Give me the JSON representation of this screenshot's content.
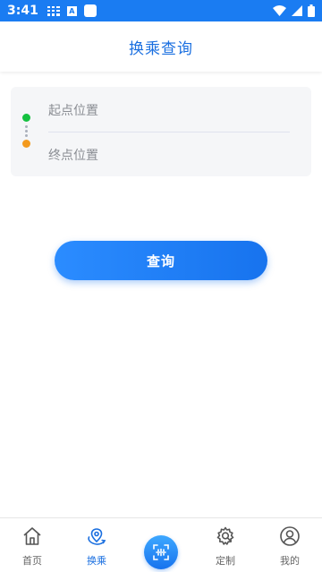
{
  "status_bar": {
    "time": "3:41",
    "badge_letter": "A"
  },
  "header": {
    "title": "换乘查询"
  },
  "route": {
    "start_placeholder": "起点位置",
    "end_placeholder": "终点位置"
  },
  "query_button": {
    "label": "查询"
  },
  "tabbar": {
    "items": [
      {
        "label": "首页",
        "icon": "home-icon"
      },
      {
        "label": "换乘",
        "icon": "transfer-location-icon",
        "active": true
      },
      {
        "label": "",
        "icon": "scan-icon"
      },
      {
        "label": "定制",
        "icon": "custom-gear-icon"
      },
      {
        "label": "我的",
        "icon": "profile-icon"
      }
    ]
  },
  "colors": {
    "primary": "#1a7cf2",
    "start_dot": "#15c140",
    "end_dot": "#f39a1e"
  }
}
